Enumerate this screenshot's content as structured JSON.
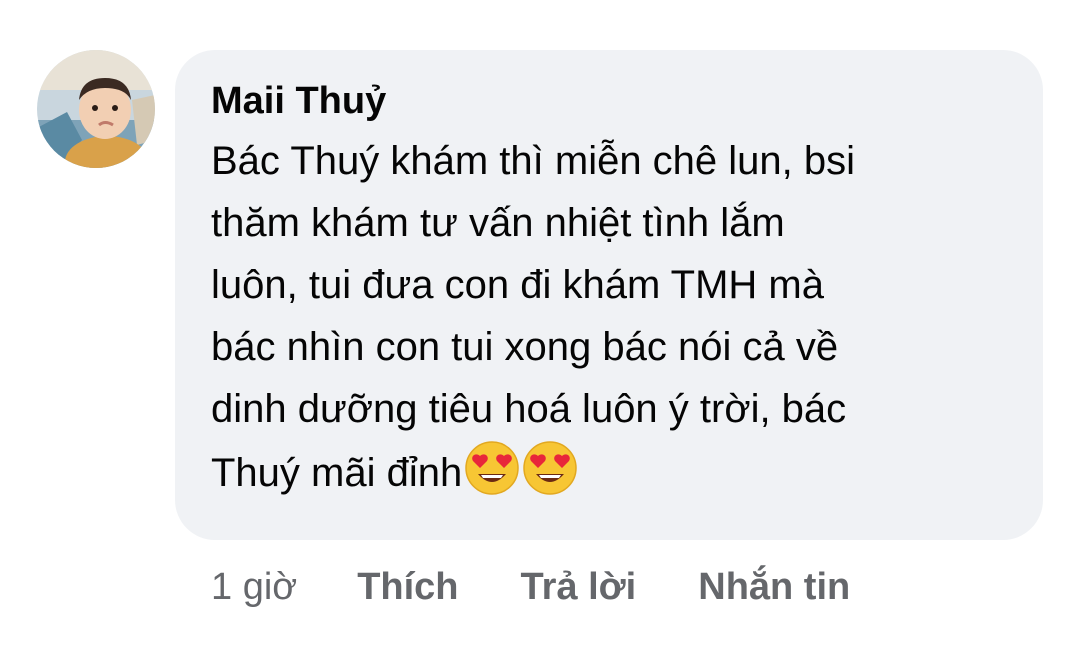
{
  "comment": {
    "author": "Maii Thuỷ",
    "lines": [
      "Bác Thuý khám thì miễn chê lun, bsi",
      "thăm khám tư vấn nhiệt tình lắm",
      "luôn, tui đưa con đi khám TMH mà",
      "bác nhìn con tui xong bác nói cả về",
      "dinh dưỡng tiêu hoá luôn ý trời, bác",
      "Thuý mãi đỉnh"
    ],
    "emojis": [
      "heart-eyes-emoji",
      "heart-eyes-emoji"
    ],
    "bubble_color": "#f0f2f5",
    "text_color": "#050505"
  },
  "actions": {
    "time": "1 giờ",
    "like": "Thích",
    "reply": "Trả lời",
    "message": "Nhắn tin",
    "color": "#65676b"
  }
}
